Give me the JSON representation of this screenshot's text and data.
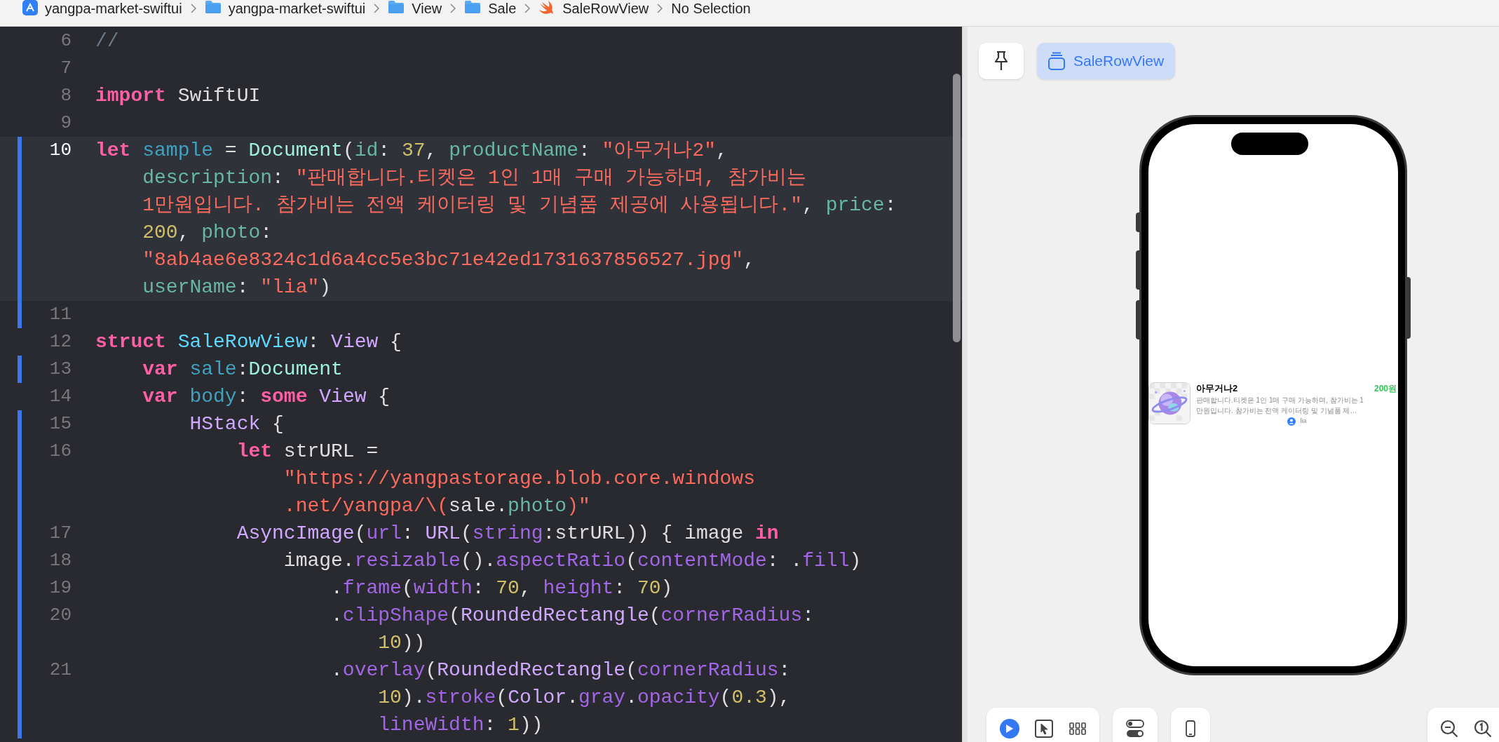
{
  "breadcrumbs": [
    {
      "kind": "app",
      "label": "yangpa-market-swiftui"
    },
    {
      "kind": "folder",
      "label": "yangpa-market-swiftui"
    },
    {
      "kind": "folder",
      "label": "View"
    },
    {
      "kind": "folder",
      "label": "Sale"
    },
    {
      "kind": "swift",
      "label": "SaleRowView"
    },
    {
      "kind": "plain",
      "label": "No Selection"
    }
  ],
  "editor": {
    "lines": [
      {
        "number": "6",
        "current": false,
        "changed": false,
        "rows": [
          {
            "segments": [
              {
                "kind": "cm",
                "text": "//"
              }
            ]
          }
        ]
      },
      {
        "number": "7",
        "current": false,
        "changed": false
      },
      {
        "number": "8",
        "current": false,
        "changed": false,
        "rows": [
          {
            "segments": [
              {
                "kind": "kw",
                "text": "import"
              },
              {
                "kind": "pl",
                "text": " SwiftUI"
              }
            ]
          }
        ]
      },
      {
        "number": "9",
        "current": false,
        "changed": false
      },
      {
        "number": "10",
        "current": true,
        "changed": true,
        "rows": [
          {
            "segments": [
              {
                "kind": "kw",
                "text": "let"
              },
              {
                "kind": "decl",
                "text": " sample"
              },
              {
                "kind": "pl",
                "text": " = "
              },
              {
                "kind": "ptype",
                "text": "Document"
              },
              {
                "kind": "pl",
                "text": "("
              },
              {
                "kind": "param",
                "text": "id"
              },
              {
                "kind": "pl",
                "text": ": "
              },
              {
                "kind": "num",
                "text": "37"
              },
              {
                "kind": "pl",
                "text": ", "
              },
              {
                "kind": "param",
                "text": "productName"
              },
              {
                "kind": "pl",
                "text": ": "
              },
              {
                "kind": "str",
                "text": "\"아무거나2\""
              },
              {
                "kind": "pl",
                "text": ","
              }
            ]
          },
          {
            "segments": [
              {
                "kind": "param",
                "text": "    description"
              },
              {
                "kind": "pl",
                "text": ": "
              },
              {
                "kind": "str",
                "text": "\"판매합니다.티켓은 1인 1매 구매 가능하며, 참가비는"
              }
            ]
          },
          {
            "segments": [
              {
                "kind": "str",
                "text": "    1만원입니다. 참가비는 전액 케이터링 및 기념품 제공에 사용됩니다.\""
              },
              {
                "kind": "pl",
                "text": ", "
              },
              {
                "kind": "param",
                "text": "price"
              },
              {
                "kind": "pl",
                "text": ":"
              }
            ]
          },
          {
            "segments": [
              {
                "kind": "num",
                "text": "    200"
              },
              {
                "kind": "pl",
                "text": ", "
              },
              {
                "kind": "param",
                "text": "photo"
              },
              {
                "kind": "pl",
                "text": ":"
              }
            ]
          },
          {
            "segments": [
              {
                "kind": "str",
                "text": "    \"8ab4ae6e8324c1d6a4cc5e3bc71e42ed1731637856527.jpg\""
              },
              {
                "kind": "pl",
                "text": ","
              }
            ]
          },
          {
            "segments": [
              {
                "kind": "param",
                "text": "    userName"
              },
              {
                "kind": "pl",
                "text": ": "
              },
              {
                "kind": "str",
                "text": "\"lia\""
              },
              {
                "kind": "pl",
                "text": ")"
              }
            ]
          }
        ]
      },
      {
        "number": "11",
        "current": false,
        "changed": true
      },
      {
        "number": "12",
        "current": false,
        "changed": false,
        "rows": [
          {
            "segments": [
              {
                "kind": "kw",
                "text": "struct"
              },
              {
                "kind": "tdecl",
                "text": " SaleRowView"
              },
              {
                "kind": "pl",
                "text": ": "
              },
              {
                "kind": "stype",
                "text": "View"
              },
              {
                "kind": "pl",
                "text": " {"
              }
            ]
          }
        ]
      },
      {
        "number": "13",
        "current": false,
        "changed": true,
        "rows": [
          {
            "segments": [
              {
                "kind": "kw",
                "text": "    var"
              },
              {
                "kind": "decl",
                "text": " sale"
              },
              {
                "kind": "pl",
                "text": ":"
              },
              {
                "kind": "ptype",
                "text": "Document"
              }
            ]
          }
        ]
      },
      {
        "number": "14",
        "current": false,
        "changed": false,
        "rows": [
          {
            "segments": [
              {
                "kind": "kw",
                "text": "    var"
              },
              {
                "kind": "decl",
                "text": " body"
              },
              {
                "kind": "pl",
                "text": ": "
              },
              {
                "kind": "kw",
                "text": "some"
              },
              {
                "kind": "stype",
                "text": " View"
              },
              {
                "kind": "pl",
                "text": " {"
              }
            ]
          }
        ]
      },
      {
        "number": "15",
        "current": false,
        "changed": true,
        "rows": [
          {
            "segments": [
              {
                "kind": "stype",
                "text": "        HStack"
              },
              {
                "kind": "pl",
                "text": " {"
              }
            ]
          }
        ]
      },
      {
        "number": "16",
        "current": false,
        "changed": true,
        "rows": [
          {
            "segments": [
              {
                "kind": "kw",
                "text": "            let"
              },
              {
                "kind": "pl",
                "text": " strURL ="
              }
            ]
          },
          {
            "segments": [
              {
                "kind": "str",
                "text": "                \"https://yangpastorage.blob.core.windows"
              }
            ]
          },
          {
            "segments": [
              {
                "kind": "str",
                "text": "                .net/yangpa/\\("
              },
              {
                "kind": "pl",
                "text": "sale."
              },
              {
                "kind": "param",
                "text": "photo"
              },
              {
                "kind": "str",
                "text": ")\""
              }
            ]
          }
        ]
      },
      {
        "number": "17",
        "current": false,
        "changed": true,
        "rows": [
          {
            "segments": [
              {
                "kind": "stype",
                "text": "            AsyncImage"
              },
              {
                "kind": "pl",
                "text": "("
              },
              {
                "kind": "fn",
                "text": "url"
              },
              {
                "kind": "pl",
                "text": ": "
              },
              {
                "kind": "stype",
                "text": "URL"
              },
              {
                "kind": "pl",
                "text": "("
              },
              {
                "kind": "fn",
                "text": "string"
              },
              {
                "kind": "pl",
                "text": ":strURL)) { image "
              },
              {
                "kind": "kw",
                "text": "in"
              }
            ]
          }
        ]
      },
      {
        "number": "18",
        "current": false,
        "changed": true,
        "rows": [
          {
            "segments": [
              {
                "kind": "pl",
                "text": "                image."
              },
              {
                "kind": "fn",
                "text": "resizable"
              },
              {
                "kind": "pl",
                "text": "()."
              },
              {
                "kind": "fn",
                "text": "aspectRatio"
              },
              {
                "kind": "pl",
                "text": "("
              },
              {
                "kind": "fn",
                "text": "contentMode"
              },
              {
                "kind": "pl",
                "text": ": ."
              },
              {
                "kind": "fn",
                "text": "fill"
              },
              {
                "kind": "pl",
                "text": ")"
              }
            ]
          }
        ]
      },
      {
        "number": "19",
        "current": false,
        "changed": true,
        "rows": [
          {
            "segments": [
              {
                "kind": "pl",
                "text": "                    ."
              },
              {
                "kind": "fn",
                "text": "frame"
              },
              {
                "kind": "pl",
                "text": "("
              },
              {
                "kind": "fn",
                "text": "width"
              },
              {
                "kind": "pl",
                "text": ": "
              },
              {
                "kind": "num",
                "text": "70"
              },
              {
                "kind": "pl",
                "text": ", "
              },
              {
                "kind": "fn",
                "text": "height"
              },
              {
                "kind": "pl",
                "text": ": "
              },
              {
                "kind": "num",
                "text": "70"
              },
              {
                "kind": "pl",
                "text": ")"
              }
            ]
          }
        ]
      },
      {
        "number": "20",
        "current": false,
        "changed": true,
        "rows": [
          {
            "segments": [
              {
                "kind": "pl",
                "text": "                    ."
              },
              {
                "kind": "fn",
                "text": "clipShape"
              },
              {
                "kind": "pl",
                "text": "("
              },
              {
                "kind": "stype",
                "text": "RoundedRectangle"
              },
              {
                "kind": "pl",
                "text": "("
              },
              {
                "kind": "fn",
                "text": "cornerRadius"
              },
              {
                "kind": "pl",
                "text": ":"
              }
            ]
          },
          {
            "segments": [
              {
                "kind": "num",
                "text": "                        10"
              },
              {
                "kind": "pl",
                "text": "))"
              }
            ]
          }
        ]
      },
      {
        "number": "21",
        "current": false,
        "changed": true,
        "rows": [
          {
            "segments": [
              {
                "kind": "pl",
                "text": "                    ."
              },
              {
                "kind": "fn",
                "text": "overlay"
              },
              {
                "kind": "pl",
                "text": "("
              },
              {
                "kind": "stype",
                "text": "RoundedRectangle"
              },
              {
                "kind": "pl",
                "text": "("
              },
              {
                "kind": "fn",
                "text": "cornerRadius"
              },
              {
                "kind": "pl",
                "text": ":"
              }
            ]
          },
          {
            "segments": [
              {
                "kind": "num",
                "text": "                        10"
              },
              {
                "kind": "pl",
                "text": ")."
              },
              {
                "kind": "fn",
                "text": "stroke"
              },
              {
                "kind": "pl",
                "text": "("
              },
              {
                "kind": "stype",
                "text": "Color"
              },
              {
                "kind": "pl",
                "text": "."
              },
              {
                "kind": "fn",
                "text": "gray"
              },
              {
                "kind": "pl",
                "text": "."
              },
              {
                "kind": "fn",
                "text": "opacity"
              },
              {
                "kind": "pl",
                "text": "("
              },
              {
                "kind": "num",
                "text": "0.3"
              },
              {
                "kind": "pl",
                "text": "),"
              }
            ]
          },
          {
            "segments": [
              {
                "kind": "fn",
                "text": "                        lineWidth"
              },
              {
                "kind": "pl",
                "text": ": "
              },
              {
                "kind": "num",
                "text": "1"
              },
              {
                "kind": "pl",
                "text": "))"
              }
            ]
          }
        ]
      }
    ]
  },
  "preview": {
    "mode_button": {
      "label": "SaleRowView",
      "selected": true
    },
    "row": {
      "title": "아무거나2",
      "price": "200원",
      "description_lines": [
        "판매합니다.티켓은 1인 1매 구매 가능하며, 참가비는 1",
        "만원입니다. 참가비는 전액 케이터링 및 기념품 제…"
      ],
      "user": "lia"
    },
    "live_button": {
      "selected": true
    }
  }
}
